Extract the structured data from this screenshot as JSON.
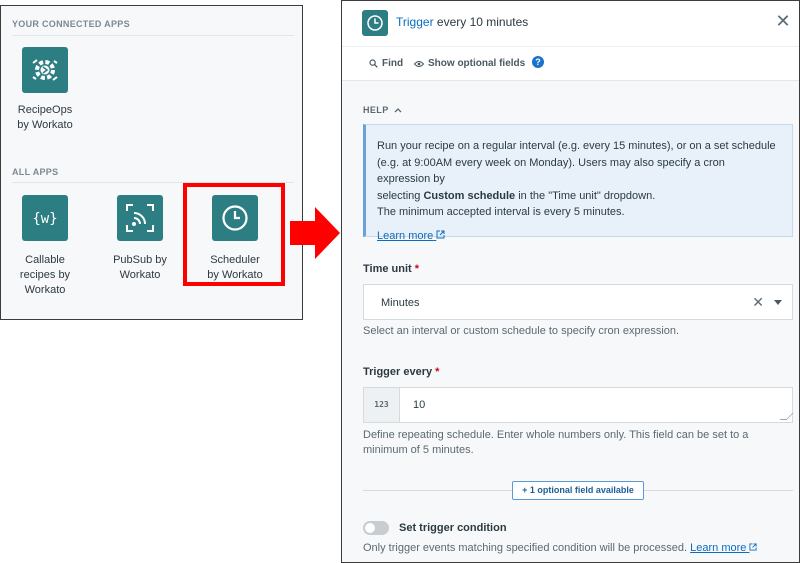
{
  "left_panel": {
    "connected_heading": "YOUR CONNECTED APPS",
    "all_heading": "ALL APPS",
    "connected_apps": [
      {
        "label_line1": "RecipeOps",
        "label_line2": "by Workato",
        "icon": "recipeops-icon"
      }
    ],
    "all_apps": [
      {
        "label_line1": "Callable",
        "label_line2": "recipes by",
        "label_line3": "Workato",
        "icon": "callable-recipes-icon"
      },
      {
        "label_line1": "PubSub by",
        "label_line2": "Workato",
        "icon": "pubsub-icon"
      },
      {
        "label_line1": "Scheduler",
        "label_line2": "by Workato",
        "icon": "clock-icon",
        "highlighted": true
      }
    ]
  },
  "panel": {
    "header": {
      "title_highlight": "Trigger",
      "title_rest": " every 10 minutes",
      "icon": "clock-icon"
    },
    "toolbar": {
      "find_label": "Find",
      "optional_label": "Show optional fields",
      "help_glyph": "?"
    },
    "help": {
      "toggle_label": "HELP",
      "line1": "Run your recipe on a regular interval (e.g. every 15 minutes), or on a set schedule",
      "line2": "(e.g. at 9:00AM every week on Monday). Users may also specify a cron expression by",
      "line3_pre": "selecting ",
      "line3_bold": "Custom schedule",
      "line3_post": " in the \"Time unit\" dropdown.",
      "line4": "The minimum accepted interval is every 5 minutes.",
      "learn_more": "Learn more"
    },
    "time_unit": {
      "label": "Time unit",
      "value": "Minutes",
      "hint": "Select an interval or custom schedule to specify cron expression."
    },
    "trigger_every": {
      "label": "Trigger every",
      "badge": "123",
      "value": "10",
      "hint": "Define repeating schedule. Enter whole numbers only. This field can be set to a minimum of 5 minutes."
    },
    "optional_button": "+ 1 optional field available",
    "trigger_condition": {
      "label": "Set trigger condition",
      "enabled": false,
      "hint": "Only trigger events matching specified condition will be processed.",
      "learn_more": "Learn more"
    }
  },
  "colors": {
    "accent": "#2d7e83",
    "link": "#0a6dbf",
    "highlight": "#ff0000"
  }
}
